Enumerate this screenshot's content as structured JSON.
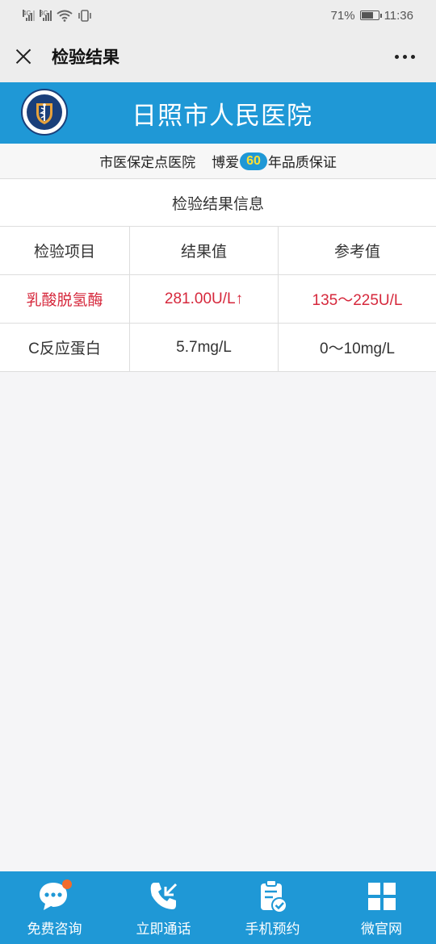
{
  "status_bar": {
    "net1": "4G",
    "net2": "3G",
    "battery": "71%",
    "battery_level": 0.71,
    "time": "11:36"
  },
  "nav": {
    "title": "检验结果"
  },
  "banner": {
    "title": "日照市人民医院"
  },
  "slogan": {
    "part1": "市医保定点医院",
    "part2": "博爱",
    "badge": "60",
    "part3": "年品质保证"
  },
  "results": {
    "title": "检验结果信息",
    "headers": [
      "检验项目",
      "结果值",
      "参考值"
    ],
    "rows": [
      {
        "item": "乳酸脱氢酶",
        "value": "281.00U/L↑",
        "reference": "135～225U/L",
        "abnormal": true
      },
      {
        "item": "C反应蛋白",
        "value": "5.7mg/L",
        "reference": "0～10mg/L",
        "abnormal": false
      }
    ]
  },
  "bottom_nav": {
    "items": [
      {
        "label": "免费咨询",
        "icon": "chat-icon"
      },
      {
        "label": "立即通话",
        "icon": "phone-icon"
      },
      {
        "label": "手机预约",
        "icon": "clipboard-check-icon"
      },
      {
        "label": "微官网",
        "icon": "grid-icon"
      }
    ]
  },
  "colors": {
    "brand_blue": "#1f98d6",
    "abnormal_red": "#d6283c",
    "badge_yellow": "#ffe033",
    "notification_orange": "#f26b2b"
  }
}
